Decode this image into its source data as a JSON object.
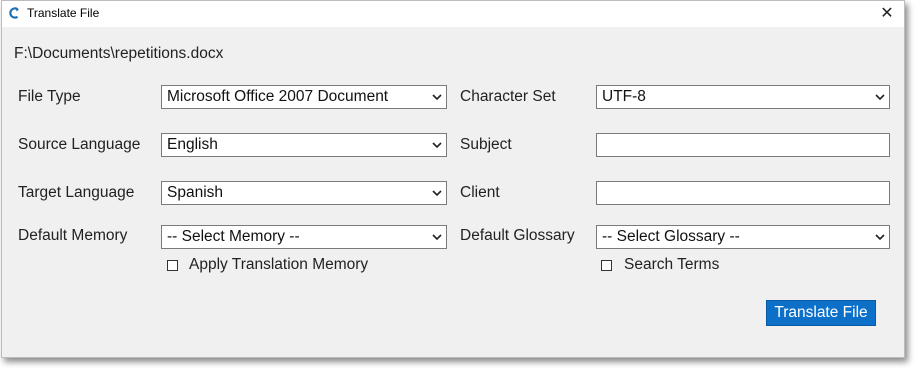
{
  "window": {
    "title": "Translate File",
    "close_glyph": "✕"
  },
  "file_path": "F:\\Documents\\repetitions.docx",
  "form": {
    "file_type": {
      "label": "File Type",
      "value": "Microsoft Office 2007 Document"
    },
    "character_set": {
      "label": "Character Set",
      "value": "UTF-8"
    },
    "source_language": {
      "label": "Source Language",
      "value": "English"
    },
    "subject": {
      "label": "Subject",
      "value": ""
    },
    "target_language": {
      "label": "Target Language",
      "value": "Spanish"
    },
    "client": {
      "label": "Client",
      "value": ""
    },
    "default_memory": {
      "label": "Default Memory",
      "value": "-- Select Memory --"
    },
    "default_glossary": {
      "label": "Default Glossary",
      "value": "-- Select Glossary --"
    },
    "apply_translation_memory": {
      "label": "Apply Translation Memory",
      "checked": false
    },
    "search_terms": {
      "label": "Search Terms",
      "checked": false
    }
  },
  "actions": {
    "translate_label": "Translate File"
  },
  "colors": {
    "primary_button": "#0c70c9",
    "dialog_bg": "#f0f0f0",
    "icon_accent": "#1f6fb5"
  }
}
